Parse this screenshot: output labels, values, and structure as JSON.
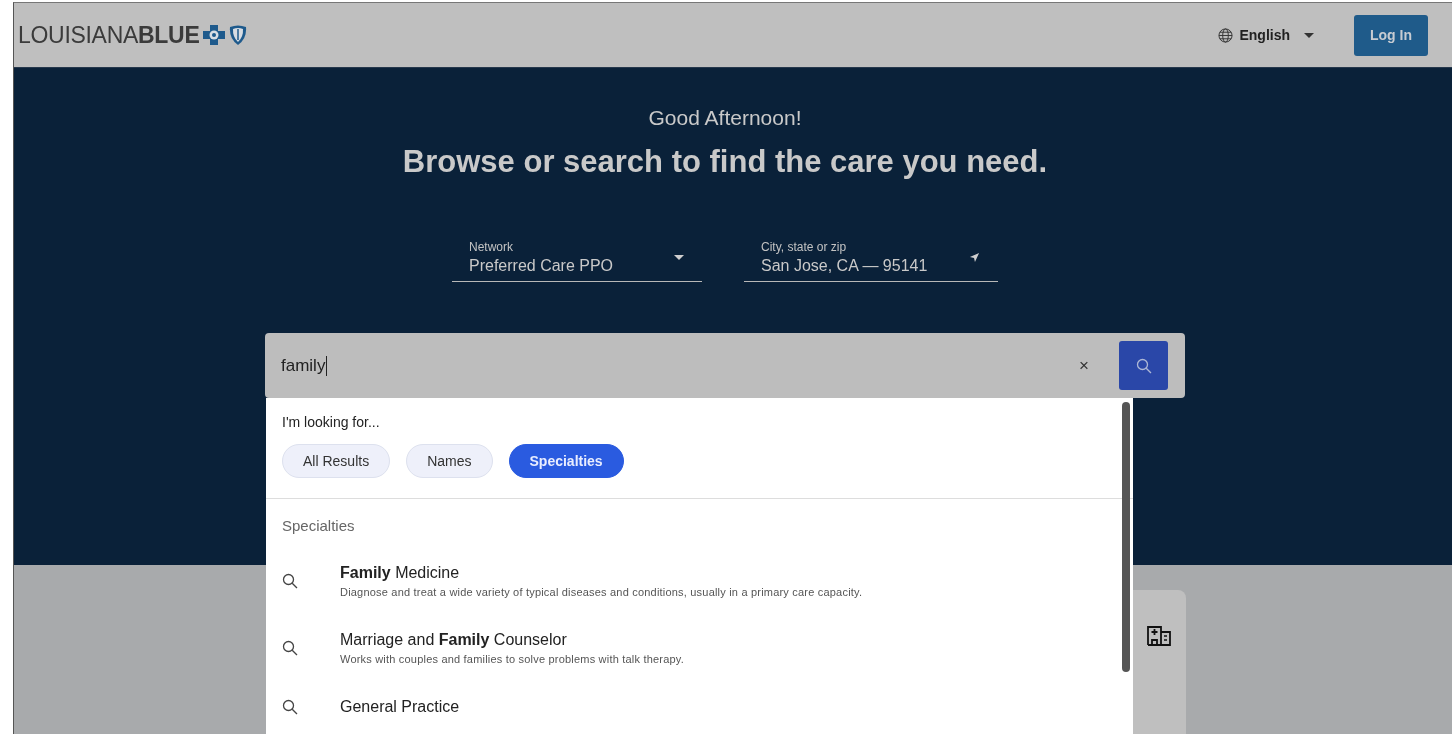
{
  "header": {
    "logo": "LOUISIANA**BLUE**",
    "language": "English",
    "login": "Log In"
  },
  "hero": {
    "greeting": "Good Afternoon!",
    "heading": "Browse or search to find the care you need.",
    "fields": [
      {
        "kind": "dropdown",
        "label": "Network",
        "value": "Preferred Care PPO"
      },
      {
        "kind": "location",
        "label": "City, state or zip",
        "value": "San Jose, CA — 95141"
      }
    ]
  },
  "search": {
    "value": "family",
    "clear": "×"
  },
  "suggestions": {
    "prompt": "I'm looking for...",
    "filters": [
      {
        "label": "All Results",
        "selected": false
      },
      {
        "label": "Names",
        "selected": false
      },
      {
        "label": "Specialties",
        "selected": true
      }
    ],
    "section": "Specialties",
    "items": [
      {
        "title": "**Family** Medicine",
        "description": "Diagnose and treat a wide variety of typical diseases and conditions, usually in a primary care capacity."
      },
      {
        "title": "Marriage and **Family** Counselor",
        "description": "Works with couples and families to solve problems with talk therapy."
      },
      {
        "title": "General Practice"
      }
    ]
  }
}
